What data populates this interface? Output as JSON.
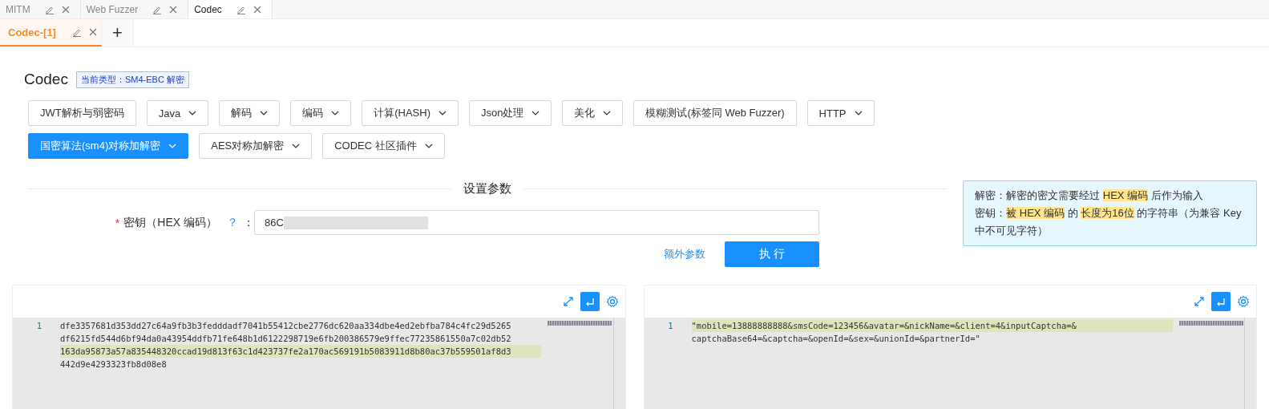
{
  "top_tabs": [
    {
      "label": "MITM",
      "selected": false
    },
    {
      "label": "Web Fuzzer",
      "selected": false
    },
    {
      "label": "Codec",
      "selected": true
    }
  ],
  "sub_tabs": [
    {
      "label": "Codec-[1]",
      "selected": true
    }
  ],
  "add_tab": "+",
  "title": "Codec",
  "current_type": "当前类型：SM4-EBC 解密",
  "tool_buttons": [
    [
      {
        "label": "JWT解析与弱密码",
        "dropdown": false,
        "selected": false
      },
      {
        "label": "Java",
        "dropdown": true,
        "selected": false
      },
      {
        "label": "解码",
        "dropdown": true,
        "selected": false
      },
      {
        "label": "编码",
        "dropdown": true,
        "selected": false
      },
      {
        "label": "计算(HASH)",
        "dropdown": true,
        "selected": false
      },
      {
        "label": "Json处理",
        "dropdown": true,
        "selected": false
      },
      {
        "label": "美化",
        "dropdown": true,
        "selected": false
      },
      {
        "label": "模糊测试(标签同 Web Fuzzer)",
        "dropdown": false,
        "selected": false
      },
      {
        "label": "HTTP",
        "dropdown": true,
        "selected": false
      }
    ],
    [
      {
        "label": "国密算法(sm4)对称加解密",
        "dropdown": true,
        "selected": true
      },
      {
        "label": "AES对称加解密",
        "dropdown": true,
        "selected": false
      },
      {
        "label": "CODEC 社区插件",
        "dropdown": true,
        "selected": false
      }
    ]
  ],
  "section_title": "设置参数",
  "key_field": {
    "required_mark": "*",
    "label": "密钥（HEX 编码）",
    "help": "？",
    "colon": "：",
    "value": "86C",
    "redacted": true
  },
  "extra_link": "额外参数",
  "run_button": "执 行",
  "tip": [
    [
      {
        "text": "解密：解密的密文需要经过 ",
        "highlight": false
      },
      {
        "text": "HEX 编码",
        "highlight": true
      },
      {
        "text": " 后作为输入",
        "highlight": false
      }
    ],
    [
      {
        "text": "密钥：",
        "highlight": false
      },
      {
        "text": "被 HEX 编码",
        "highlight": true
      },
      {
        "text": " 的 ",
        "highlight": false
      },
      {
        "text": "长度为16位",
        "highlight": true
      },
      {
        "text": " 的字符串（为兼容 Key 中不可见字符）",
        "highlight": false
      }
    ]
  ],
  "editors": [
    {
      "line_number": "1",
      "lines": [
        {
          "text": "dfe3357681d353dd27c64a9fb3b3fedddadf7041b55412cbe2776dc620aa334dbe4ed2ebfba784c4fc29d5265",
          "highlight": false
        },
        {
          "text": "df6215fd544d6bf94da0a43954ddfb71fe648b1d6122298719e6fb200386579e9ffec77235861550a7c02db52",
          "highlight": false
        },
        {
          "text": "163da95873a57a835448320ccad19d813f63c1d423737fe2a170ac569191b5083911d8b80ac37b559501af8d3",
          "highlight": true
        },
        {
          "text": "442d9e4293323fb8d08e8",
          "highlight": false
        }
      ],
      "wrap_on": true
    },
    {
      "line_number": "1",
      "lines": [
        {
          "text": "\"mobile=13888888888&smsCode=123456&avatar=&nickName=&client=4&inputCaptcha=&",
          "highlight": true
        },
        {
          "text": "captchaBase64=&captcha=&openId=&sex=&unionId=&partnerId=\"",
          "highlight": false
        }
      ],
      "wrap_on": true
    }
  ]
}
